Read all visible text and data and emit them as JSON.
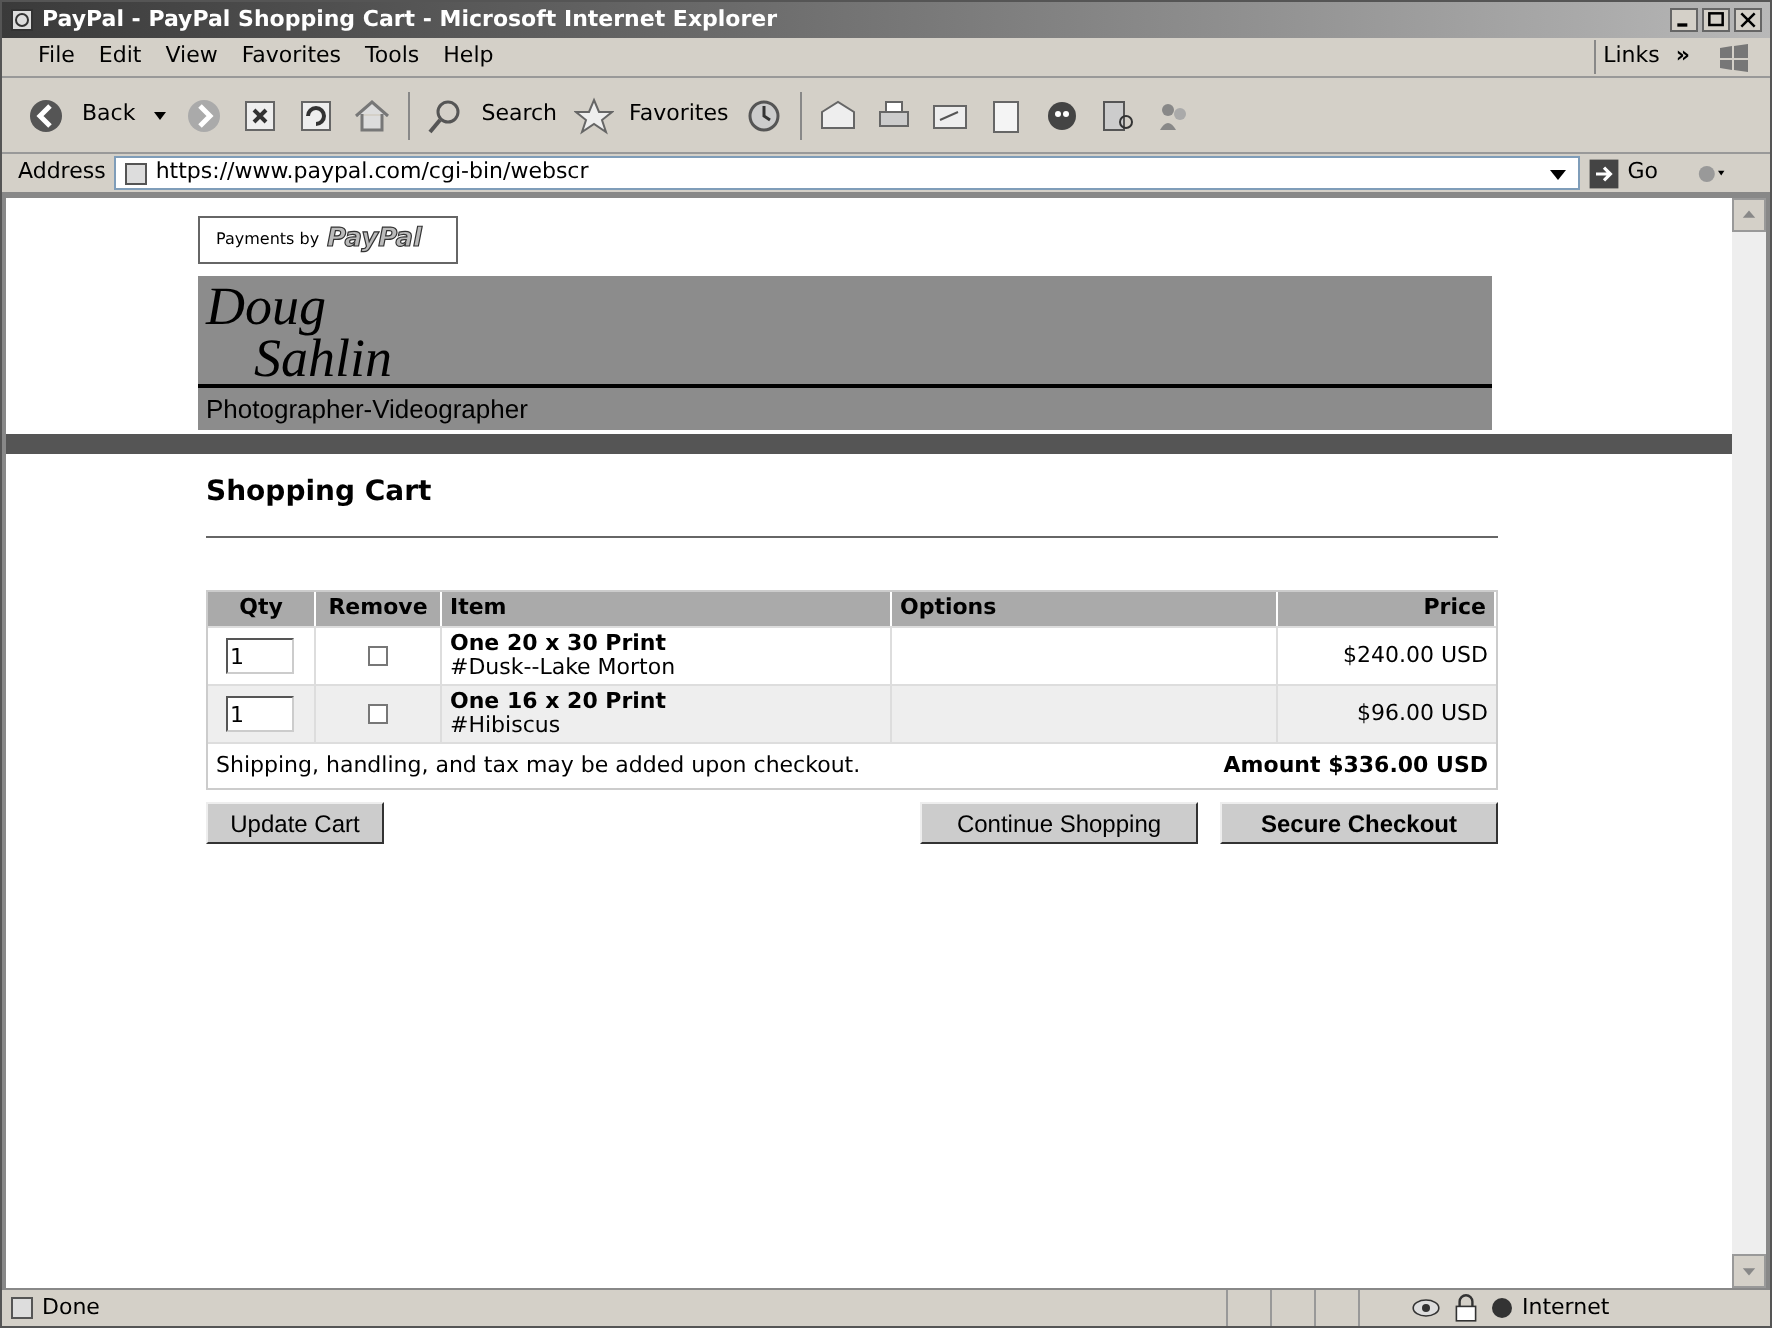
{
  "window": {
    "title": "PayPal - PayPal Shopping Cart - Microsoft Internet Explorer"
  },
  "menu": [
    "File",
    "Edit",
    "View",
    "Favorites",
    "Tools",
    "Help"
  ],
  "links_label": "Links",
  "links_chevron": "»",
  "toolbar": {
    "back": "Back",
    "search": "Search",
    "favorites": "Favorites"
  },
  "address": {
    "label": "Address",
    "value": "https://www.paypal.com/cgi-bin/webscr",
    "go": "Go"
  },
  "badge": {
    "prefix": "Payments by",
    "brand": "PayPal"
  },
  "banner": {
    "first": "Doug",
    "last": "Sahlin",
    "tagline": "Photographer-Videographer"
  },
  "heading": "Shopping Cart",
  "table": {
    "columns": [
      "Qty",
      "Remove",
      "Item",
      "Options",
      "Price"
    ],
    "rows": [
      {
        "qty": "1",
        "remove": false,
        "title": "One 20 x 30 Print",
        "subtitle": "#Dusk--Lake Morton",
        "price": "$240.00 USD"
      },
      {
        "qty": "1",
        "remove": false,
        "title": "One 16 x 20 Print",
        "subtitle": "#Hibiscus",
        "price": "$96.00 USD"
      }
    ],
    "note": "Shipping, handling, and tax may be added upon checkout.",
    "total": "Amount $336.00 USD"
  },
  "buttons": {
    "update": "Update Cart",
    "continue": "Continue Shopping",
    "checkout": "Secure Checkout"
  },
  "status_bar": {
    "text": "Done",
    "zone": "Internet"
  }
}
